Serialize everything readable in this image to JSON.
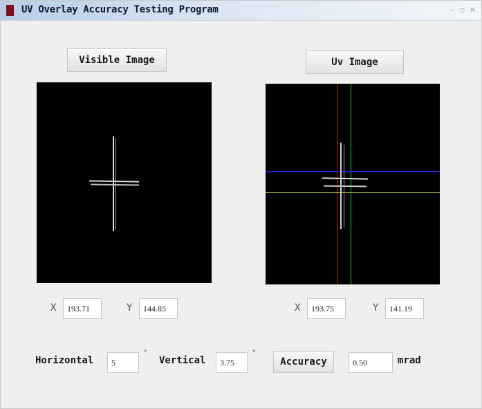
{
  "window": {
    "title": "UV Overlay Accuracy Testing Program",
    "controls": [
      "minimize-icon",
      "restore-icon",
      "close-icon"
    ]
  },
  "visible": {
    "button_label": "Visible Image",
    "x_label": "X",
    "x_value": "193.71",
    "y_label": "Y",
    "y_value": "144.85"
  },
  "uv": {
    "button_label": "Uv Image",
    "x_label": "X",
    "x_value": "193.75",
    "y_label": "Y",
    "y_value": "141.19"
  },
  "bottom": {
    "horizontal_label": "Horizontal",
    "horizontal_value": "5",
    "degree_symbol": "°",
    "vertical_label": "Vertical",
    "vertical_value": "3.75",
    "accuracy_button": "Accuracy",
    "accuracy_value": "0.50",
    "unit_label": "mrad"
  },
  "colors": {
    "view_background": "#000000",
    "crosshair_red": "#e02020",
    "crosshair_green": "#30c030",
    "crosshair_blue": "#2020d0",
    "crosshair_yellow": "#c8c860",
    "target_white": "#e8e8e8"
  }
}
